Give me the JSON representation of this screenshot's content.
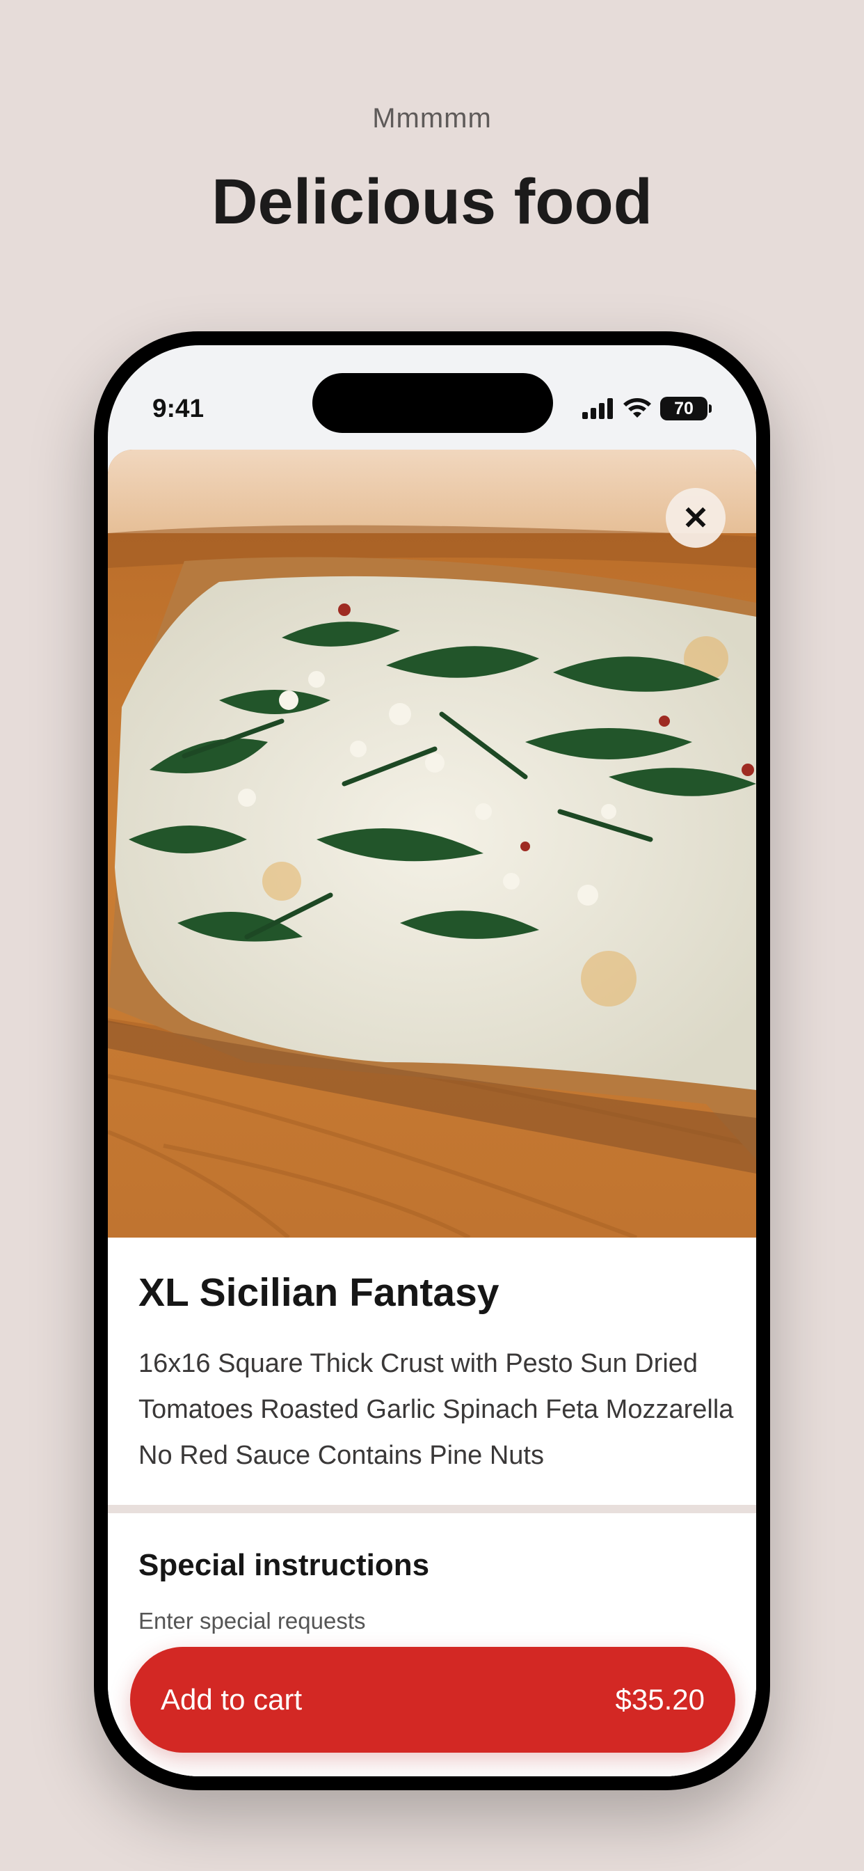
{
  "header": {
    "eyebrow": "Mmmmm",
    "headline": "Delicious food"
  },
  "status_bar": {
    "time": "9:41",
    "battery": "70",
    "icons": [
      "cellular-signal-icon",
      "wifi-icon",
      "battery-icon"
    ]
  },
  "item": {
    "image": "pizza-photo",
    "close_icon": "close-icon",
    "title": "XL Sicilian Fantasy",
    "description": "16x16 Square Thick Crust with Pesto Sun Dried Tomatoes Roasted Garlic Spinach Feta Mozzarella No Red Sauce Contains Pine Nuts"
  },
  "special_instructions": {
    "title": "Special instructions",
    "placeholder": "Enter special requests"
  },
  "cart": {
    "label": "Add to cart",
    "price": "$35.20"
  },
  "colors": {
    "background": "#e6dcd9",
    "accent": "#d32824"
  }
}
